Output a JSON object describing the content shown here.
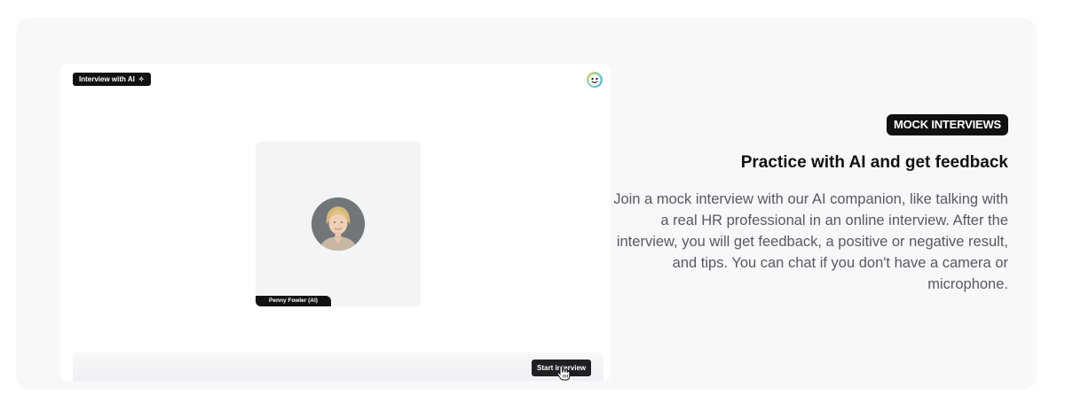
{
  "preview": {
    "badge_label": "Interview with AI",
    "badge_icon": "sparkle-icon",
    "participant_name": "Penny Fowler (AI)",
    "start_button_label": "Start interview",
    "logo_icon": "brand-logo-icon"
  },
  "feature": {
    "tag": "MOCK INTERVIEWS",
    "headline": "Practice with AI and get feedback",
    "description": "Join a mock interview with our AI companion, like talking with a real HR professional in an online interview. After the interview, you will get feedback, a positive or negative result, and tips. You can chat if you don't have a camera or microphone."
  },
  "colors": {
    "card_background": "#f7f8fa",
    "dark": "#111111",
    "body_text": "#565a60"
  }
}
